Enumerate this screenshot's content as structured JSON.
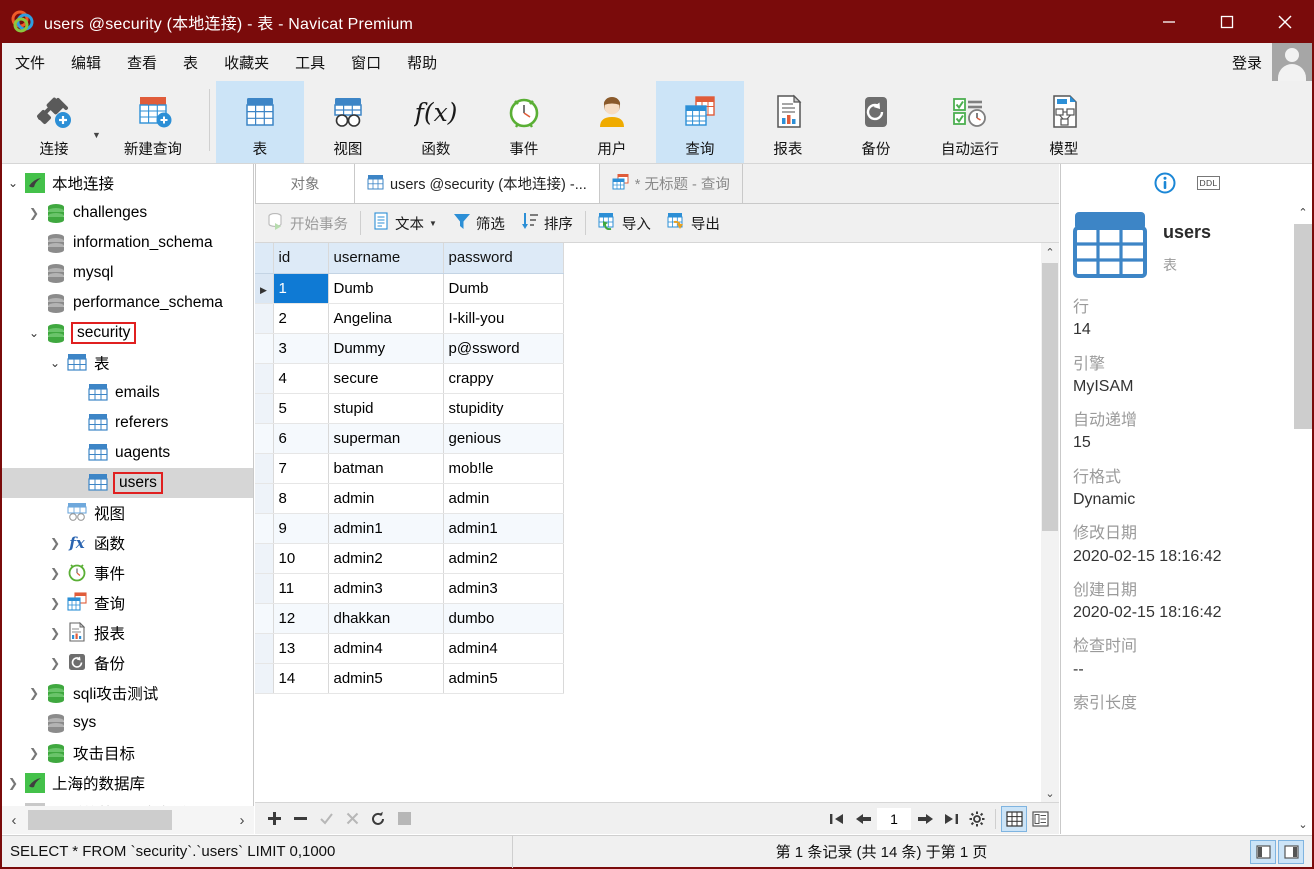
{
  "window": {
    "title": "users @security (本地连接) - 表 - Navicat Premium",
    "minimize": "minimize-icon",
    "maximize": "maximize-icon",
    "close": "close-icon"
  },
  "menubar": {
    "items": [
      "文件",
      "编辑",
      "查看",
      "表",
      "收藏夹",
      "工具",
      "窗口",
      "帮助"
    ],
    "login_label": "登录"
  },
  "ribbon": {
    "buttons": [
      {
        "label": "连接",
        "icon": "connection-icon",
        "active": false
      },
      {
        "label": "新建查询",
        "icon": "new-query-icon",
        "active": false
      },
      {
        "label": "表",
        "icon": "table-icon",
        "active": true
      },
      {
        "label": "视图",
        "icon": "view-icon",
        "active": false
      },
      {
        "label": "函数",
        "icon": "function-icon",
        "active": false
      },
      {
        "label": "事件",
        "icon": "event-icon",
        "active": false
      },
      {
        "label": "用户",
        "icon": "user-icon",
        "active": false
      },
      {
        "label": "查询",
        "icon": "query-icon",
        "active": true
      },
      {
        "label": "报表",
        "icon": "report-icon",
        "active": false
      },
      {
        "label": "备份",
        "icon": "backup-icon",
        "active": false
      },
      {
        "label": "自动运行",
        "icon": "automation-icon",
        "active": false
      },
      {
        "label": "模型",
        "icon": "model-icon",
        "active": false
      }
    ]
  },
  "sidebar": {
    "nodes": [
      {
        "label": "本地连接",
        "depth": 0,
        "twist": "open",
        "icon": "mysql-connection-icon",
        "selected": false,
        "boxed": false
      },
      {
        "label": "challenges",
        "depth": 1,
        "twist": "closed",
        "icon": "database-green-icon",
        "selected": false,
        "boxed": false
      },
      {
        "label": "information_schema",
        "depth": 1,
        "twist": "none",
        "icon": "database-gray-icon",
        "selected": false,
        "boxed": false
      },
      {
        "label": "mysql",
        "depth": 1,
        "twist": "none",
        "icon": "database-gray-icon",
        "selected": false,
        "boxed": false
      },
      {
        "label": "performance_schema",
        "depth": 1,
        "twist": "none",
        "icon": "database-gray-icon",
        "selected": false,
        "boxed": false
      },
      {
        "label": "security",
        "depth": 1,
        "twist": "open",
        "icon": "database-green-icon",
        "selected": false,
        "boxed": true
      },
      {
        "label": "表",
        "depth": 2,
        "twist": "open",
        "icon": "table-icon",
        "selected": false,
        "boxed": false
      },
      {
        "label": "emails",
        "depth": 3,
        "twist": "none",
        "icon": "table-icon",
        "selected": false,
        "boxed": false
      },
      {
        "label": "referers",
        "depth": 3,
        "twist": "none",
        "icon": "table-icon",
        "selected": false,
        "boxed": false
      },
      {
        "label": "uagents",
        "depth": 3,
        "twist": "none",
        "icon": "table-icon",
        "selected": false,
        "boxed": false
      },
      {
        "label": "users",
        "depth": 3,
        "twist": "none",
        "icon": "table-icon",
        "selected": true,
        "boxed": true
      },
      {
        "label": "视图",
        "depth": 2,
        "twist": "none",
        "icon": "view-icon",
        "selected": false,
        "boxed": false
      },
      {
        "label": "函数",
        "depth": 2,
        "twist": "closed",
        "icon": "function-icon",
        "selected": false,
        "boxed": false
      },
      {
        "label": "事件",
        "depth": 2,
        "twist": "closed",
        "icon": "event-icon",
        "selected": false,
        "boxed": false
      },
      {
        "label": "查询",
        "depth": 2,
        "twist": "closed",
        "icon": "query-icon",
        "selected": false,
        "boxed": false
      },
      {
        "label": "报表",
        "depth": 2,
        "twist": "closed",
        "icon": "report-icon",
        "selected": false,
        "boxed": false
      },
      {
        "label": "备份",
        "depth": 2,
        "twist": "closed",
        "icon": "backup-icon",
        "selected": false,
        "boxed": false
      },
      {
        "label": "sqli攻击测试",
        "depth": 1,
        "twist": "closed",
        "icon": "database-green-icon",
        "selected": false,
        "boxed": false
      },
      {
        "label": "sys",
        "depth": 1,
        "twist": "none",
        "icon": "database-gray-icon",
        "selected": false,
        "boxed": false
      },
      {
        "label": "攻击目标",
        "depth": 1,
        "twist": "closed",
        "icon": "database-green-icon",
        "selected": false,
        "boxed": false
      },
      {
        "label": "上海的数据库",
        "depth": 0,
        "twist": "closed",
        "icon": "mysql-connection-icon",
        "selected": false,
        "boxed": false
      },
      {
        "label": "寻觅的第一个数据库",
        "depth": 0,
        "twist": "none",
        "icon": "mysql-gray-icon",
        "selected": false,
        "boxed": false
      }
    ],
    "scroll_left_icon": "chevron-left-icon",
    "scroll_right_icon": "chevron-right-icon"
  },
  "tabs": [
    {
      "label": "对象",
      "icon": "none",
      "active": false,
      "dim": true
    },
    {
      "label": "users @security (本地连接) -...",
      "icon": "table-icon",
      "active": true,
      "dim": false
    },
    {
      "label": "* 无标题 - 查询",
      "icon": "query-icon",
      "active": false,
      "dim": true
    }
  ],
  "gridtools": [
    {
      "label": "开始事务",
      "icon": "transaction-icon",
      "disabled": true
    },
    {
      "label": "文本",
      "icon": "text-icon",
      "disabled": false,
      "caret": true
    },
    {
      "label": "筛选",
      "icon": "filter-icon",
      "disabled": false
    },
    {
      "label": "排序",
      "icon": "sort-icon",
      "disabled": false
    },
    {
      "label": "导入",
      "icon": "import-icon",
      "disabled": false
    },
    {
      "label": "导出",
      "icon": "export-icon",
      "disabled": false
    }
  ],
  "grid": {
    "columns": [
      "id",
      "username",
      "password"
    ],
    "rows": [
      {
        "id": "1",
        "username": "Dumb",
        "password": "Dumb"
      },
      {
        "id": "2",
        "username": "Angelina",
        "password": "I-kill-you"
      },
      {
        "id": "3",
        "username": "Dummy",
        "password": "p@ssword"
      },
      {
        "id": "4",
        "username": "secure",
        "password": "crappy"
      },
      {
        "id": "5",
        "username": "stupid",
        "password": "stupidity"
      },
      {
        "id": "6",
        "username": "superman",
        "password": "genious"
      },
      {
        "id": "7",
        "username": "batman",
        "password": "mob!le"
      },
      {
        "id": "8",
        "username": "admin",
        "password": "admin"
      },
      {
        "id": "9",
        "username": "admin1",
        "password": "admin1"
      },
      {
        "id": "10",
        "username": "admin2",
        "password": "admin2"
      },
      {
        "id": "11",
        "username": "admin3",
        "password": "admin3"
      },
      {
        "id": "12",
        "username": "dhakkan",
        "password": "dumbo"
      },
      {
        "id": "13",
        "username": "admin4",
        "password": "admin4"
      },
      {
        "id": "14",
        "username": "admin5",
        "password": "admin5"
      }
    ],
    "selected_row_index": 0,
    "selected_column": "id"
  },
  "navbar": {
    "left_icons": [
      "add-record-icon",
      "remove-record-icon",
      "apply-change-icon",
      "cancel-change-icon",
      "refresh-icon",
      "stop-icon"
    ],
    "page_value": "1",
    "right_icons": [
      "first-page-icon",
      "prev-page-icon",
      "next-page-icon",
      "last-page-icon",
      "settings-gear-icon"
    ],
    "view_grid_icon": "grid-view-icon",
    "view_form_icon": "form-view-icon"
  },
  "info_panel": {
    "tab_info_icon": "info-circle-icon",
    "tab_ddl_label": "DDL",
    "object_name": "users",
    "object_kind": "表",
    "object_icon": "table-icon",
    "properties": [
      {
        "key": "行",
        "value": "14"
      },
      {
        "key": "引擎",
        "value": "MyISAM"
      },
      {
        "key": "自动递增",
        "value": "15"
      },
      {
        "key": "行格式",
        "value": "Dynamic"
      },
      {
        "key": "修改日期",
        "value": "2020-02-15 18:16:42"
      },
      {
        "key": "创建日期",
        "value": "2020-02-15 18:16:42"
      },
      {
        "key": "检查时间",
        "value": "--"
      },
      {
        "key": "索引长度",
        "value": ""
      }
    ]
  },
  "statusbar": {
    "sql": "SELECT * FROM `security`.`users` LIMIT 0,1000",
    "record_info": "第 1 条记录 (共 14 条) 于第 1 页",
    "layout_left_icon": "panel-left-icon",
    "layout_right_icon": "panel-right-icon"
  },
  "colors": {
    "titlebar": "#7a0b0b",
    "accent_blue": "#0f7ad4",
    "ribbon_active": "#cce4f7",
    "highlight_box": "#e02020",
    "header_cell": "#ddeaf7"
  }
}
